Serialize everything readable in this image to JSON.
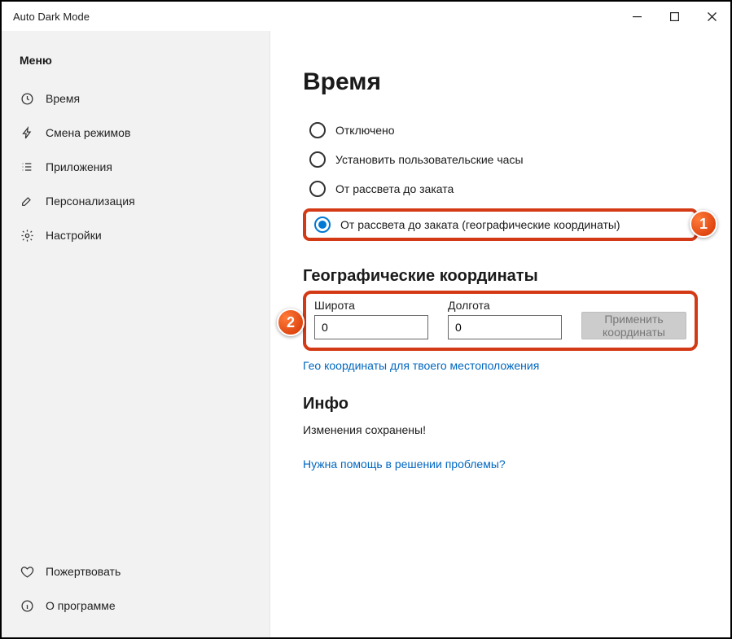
{
  "window": {
    "title": "Auto Dark Mode"
  },
  "sidebar": {
    "heading": "Меню",
    "items": [
      {
        "label": "Время"
      },
      {
        "label": "Смена режимов"
      },
      {
        "label": "Приложения"
      },
      {
        "label": "Персонализация"
      },
      {
        "label": "Настройки"
      }
    ],
    "bottom": [
      {
        "label": "Пожертвовать"
      },
      {
        "label": "О программе"
      }
    ]
  },
  "main": {
    "title": "Время",
    "radios": [
      {
        "label": "Отключено"
      },
      {
        "label": "Установить пользовательские часы"
      },
      {
        "label": "От рассвета до заката"
      },
      {
        "label": "От рассвета до заката (географические координаты)"
      }
    ],
    "coord_heading": "Географические координаты",
    "lat_label": "Широта",
    "lat_value": "0",
    "lon_label": "Долгота",
    "lon_value": "0",
    "apply_label": "Применить координаты",
    "geo_link": "Гео координаты для твоего местоположения",
    "info_heading": "Инфо",
    "info_text": "Изменения сохранены!",
    "help_link": "Нужна помощь в решении проблемы?"
  },
  "callouts": {
    "one": "1",
    "two": "2"
  }
}
